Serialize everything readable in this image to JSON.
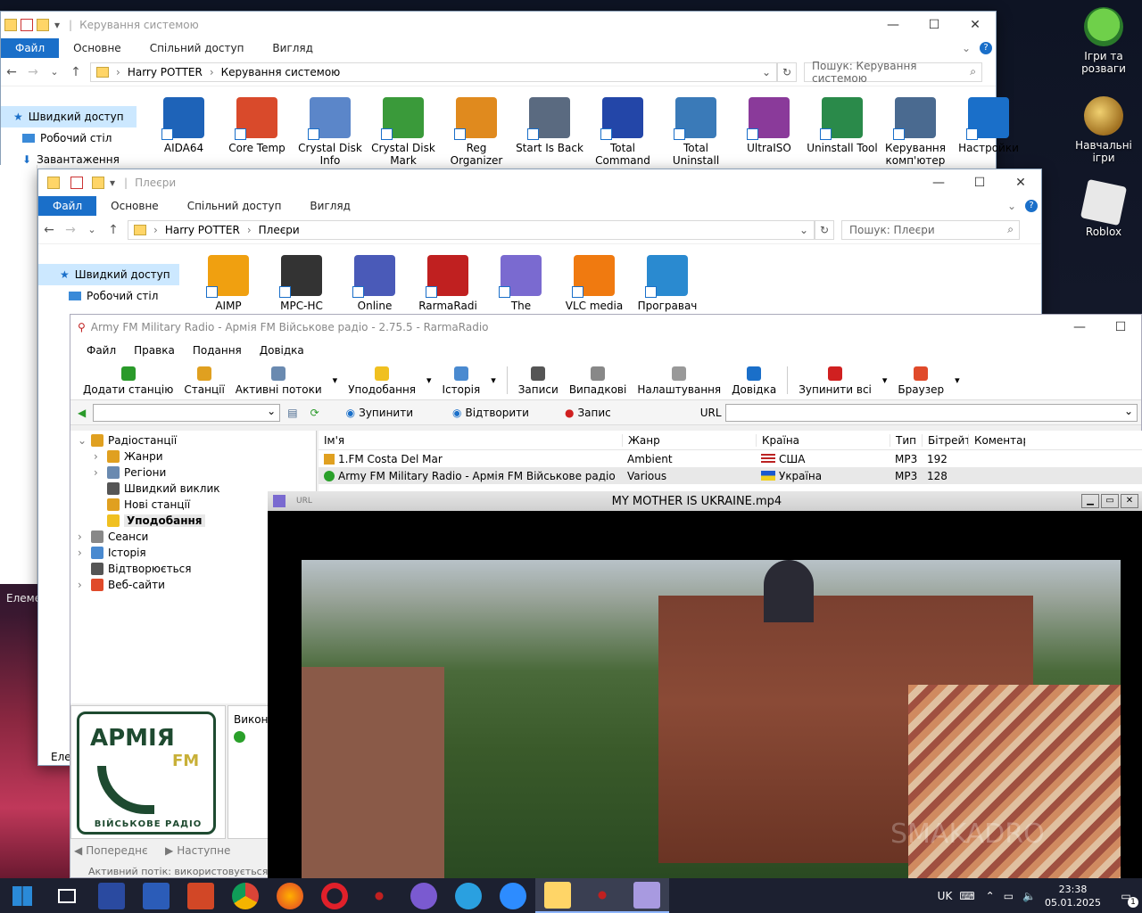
{
  "desktop": {
    "icons": [
      {
        "label": "Ігри та розваги"
      },
      {
        "label": "Навчальні ігри"
      },
      {
        "label": "Roblox"
      }
    ]
  },
  "win1": {
    "title": "Керування системою",
    "tabs": [
      "Файл",
      "Основне",
      "Спільний доступ",
      "Вигляд"
    ],
    "breadcrumb": [
      "Harry POTTER",
      "Керування системою"
    ],
    "search_placeholder": "Пошук: Керування системою",
    "nav": [
      "Швидкий доступ",
      "Робочий стіл",
      "Завантаження"
    ],
    "apps": [
      {
        "label": "AIDA64",
        "color": "#1e63b8"
      },
      {
        "label": "Core Temp",
        "color": "#d94a2b"
      },
      {
        "label": "Crystal Disk Info",
        "color": "#5b86c9"
      },
      {
        "label": "Crystal Disk Mark",
        "color": "#3a9a3a"
      },
      {
        "label": "Reg Organizer",
        "color": "#e08a1e"
      },
      {
        "label": "Start Is Back",
        "color": "#5a6a80"
      },
      {
        "label": "Total Command",
        "color": "#2346a8"
      },
      {
        "label": "Total Uninstall",
        "color": "#3a7ab8"
      },
      {
        "label": "UltraISO",
        "color": "#8a3a9a"
      },
      {
        "label": "Uninstall Tool",
        "color": "#2a8a4a"
      },
      {
        "label": "Керування комп'ютер",
        "color": "#4a6a90"
      },
      {
        "label": "Настройки",
        "color": "#1a6fc9"
      }
    ],
    "footer_partial": "Елеме"
  },
  "win2": {
    "title": "Плеєри",
    "tabs": [
      "Файл",
      "Основне",
      "Спільний доступ",
      "Вигляд"
    ],
    "breadcrumb": [
      "Harry POTTER",
      "Плеєри"
    ],
    "search_placeholder": "Пошук: Плеєри",
    "nav": [
      "Швидкий доступ",
      "Робочий стіл"
    ],
    "apps": [
      {
        "label": "AIMP",
        "color": "#f0a010"
      },
      {
        "label": "MPC-HC",
        "color": "#333333"
      },
      {
        "label": "Online",
        "color": "#4a5ab8"
      },
      {
        "label": "RarmaRadi",
        "color": "#c02020"
      },
      {
        "label": "The",
        "color": "#7a6ad0"
      },
      {
        "label": "VLC media",
        "color": "#f07a10"
      },
      {
        "label": "Програвач",
        "color": "#2a8ad0"
      }
    ],
    "footer_partial": "Елем"
  },
  "rama": {
    "title": "Army FM Military Radio - Армія FM Військове радіо - 2.75.5 - RarmaRadio",
    "menu": [
      "Файл",
      "Правка",
      "Подання",
      "Довідка"
    ],
    "toolbar": [
      {
        "label": "Додати станцію",
        "color": "#2a9a2a"
      },
      {
        "label": "Станції",
        "color": "#e0a020"
      },
      {
        "label": "Активні потоки",
        "color": "#6a8ab0"
      },
      {
        "label": "Уподобання",
        "color": "#f0c020"
      },
      {
        "label": "Історія",
        "color": "#4a8ad0"
      },
      {
        "label": "Записи",
        "color": "#555555"
      },
      {
        "label": "Випадкові",
        "color": "#888888"
      },
      {
        "label": "Налаштування",
        "color": "#999999"
      },
      {
        "label": "Довідка",
        "color": "#1a6fc9"
      },
      {
        "label": "Зупинити всі",
        "color": "#d02020"
      },
      {
        "label": "Браузер",
        "color": "#e04a2a"
      }
    ],
    "stop_label": "Зупинити",
    "play_label": "Відтворити",
    "rec_label": "Запис",
    "url_label": "URL",
    "tree": [
      "Радіостанції",
      "Жанри",
      "Регіони",
      "Швидкий виклик",
      "Нові станції",
      "Уподобання",
      "Сеанси",
      "Історія",
      "Відтворюється",
      "Веб-сайти"
    ],
    "columns": [
      "Ім'я",
      "Жанр",
      "Країна",
      "Тип",
      "Бітрейт",
      "Коментар"
    ],
    "rows": [
      {
        "name": "1.FM Costa Del Mar",
        "genre": "Ambient",
        "country": "США",
        "type": "MP3",
        "bitrate": "192"
      },
      {
        "name": "Army FM Military Radio - Армія FM Військове радіо",
        "genre": "Various",
        "country": "Україна",
        "type": "MP3",
        "bitrate": "128"
      }
    ],
    "logo_top": "АРМІЯ",
    "logo_fm": "FM",
    "logo_bottom": "ВІЙСЬКОВЕ РАДІО",
    "prev_label": "Попереднє",
    "next_label": "Наступне",
    "side_label": "Викона",
    "status_partial": "Активний потік: використовується"
  },
  "player": {
    "title": "MY MOTHER IS UKRAINE.mp4",
    "url_label": "URL",
    "watermark": "SMAKADRO"
  },
  "taskbar": {
    "lang": "UK",
    "time": "23:38",
    "date": "05.01.2025",
    "notif": "1"
  }
}
